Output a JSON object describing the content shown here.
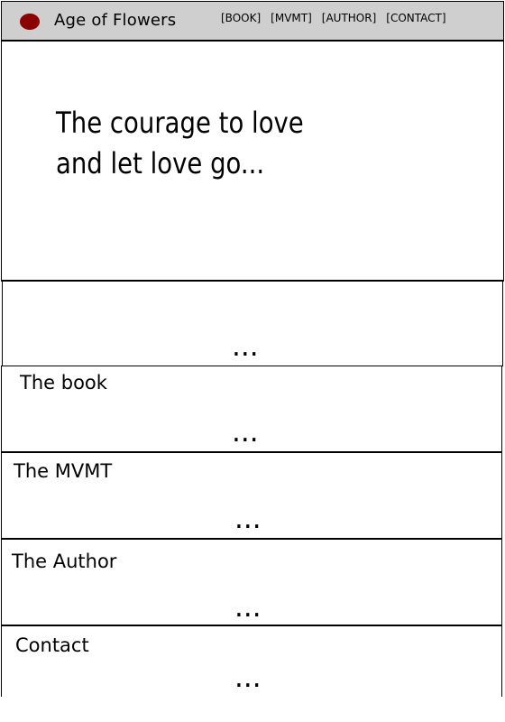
{
  "header": {
    "logo_icon": "red-oval-logo",
    "title": "Age of Flowers",
    "nav": [
      "[BOOK]",
      "[MVMT]",
      "[AUTHOR]",
      "[CONTACT]"
    ]
  },
  "hero": {
    "line1": "The courage to love",
    "line2": "and let love go..."
  },
  "sections": [
    {
      "title": "",
      "ellipsis": "..."
    },
    {
      "title": "The book",
      "ellipsis": "..."
    },
    {
      "title": "The MVMT",
      "ellipsis": "..."
    },
    {
      "title": "The Author",
      "ellipsis": "..."
    },
    {
      "title": "Contact",
      "ellipsis": "..."
    }
  ],
  "colors": {
    "header_bg": "#cfcfcf",
    "logo": "#8b0000"
  }
}
